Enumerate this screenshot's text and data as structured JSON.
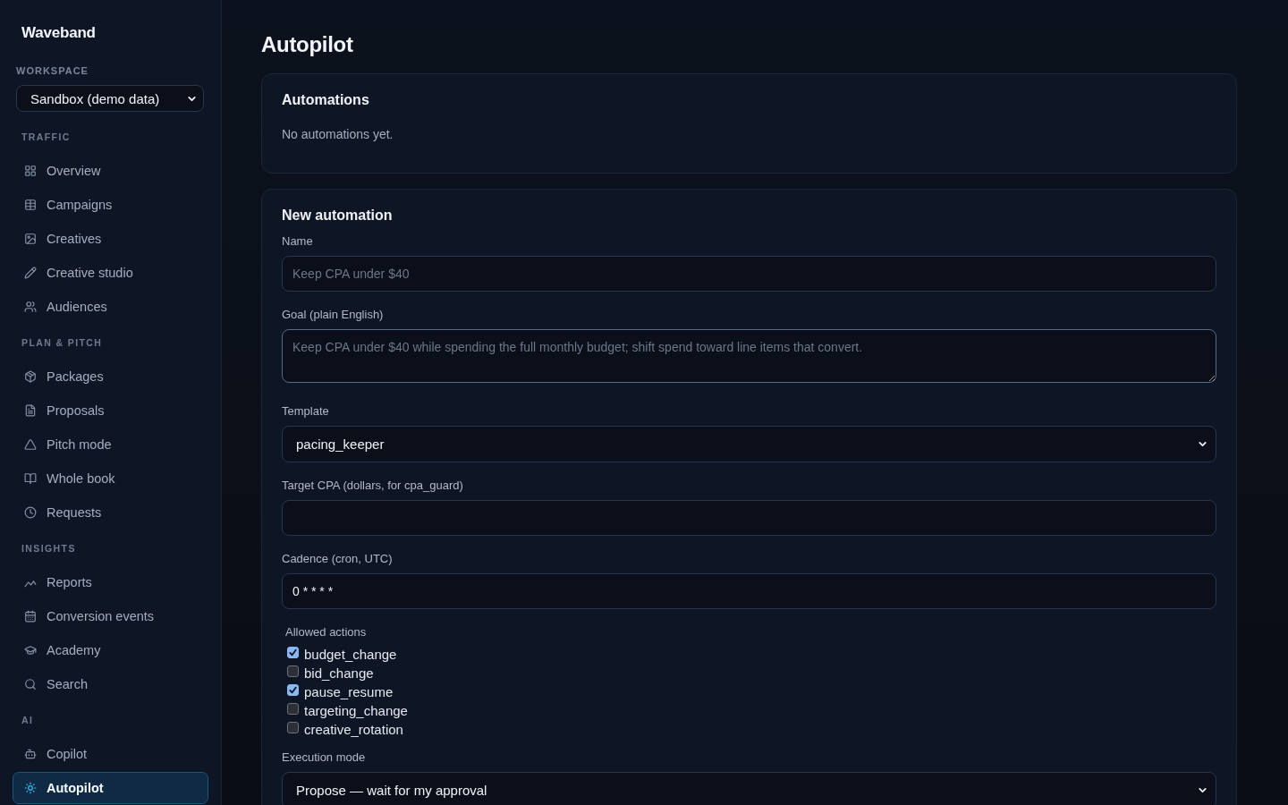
{
  "sidebar": {
    "brand": "Waveband",
    "workspace": {
      "label": "WORKSPACE",
      "value": "Sandbox (demo data)"
    },
    "sections": [
      {
        "title": "TRAFFIC",
        "items": [
          {
            "label": "Overview",
            "selected": false
          },
          {
            "label": "Campaigns",
            "selected": false
          },
          {
            "label": "Creatives",
            "selected": false
          },
          {
            "label": "Creative studio",
            "selected": false
          },
          {
            "label": "Audiences",
            "selected": false
          }
        ]
      },
      {
        "title": "PLAN & PITCH",
        "items": [
          {
            "label": "Packages",
            "selected": false
          },
          {
            "label": "Proposals",
            "selected": false
          },
          {
            "label": "Pitch mode",
            "selected": false
          },
          {
            "label": "Whole book",
            "selected": false
          },
          {
            "label": "Requests",
            "selected": false
          }
        ]
      },
      {
        "title": "INSIGHTS",
        "items": [
          {
            "label": "Reports",
            "selected": false
          },
          {
            "label": "Conversion events",
            "selected": false
          },
          {
            "label": "Academy",
            "selected": false
          },
          {
            "label": "Search",
            "selected": false
          }
        ]
      },
      {
        "title": "AI",
        "items": [
          {
            "label": "Copilot",
            "selected": false
          },
          {
            "label": "Autopilot",
            "selected": true
          }
        ]
      }
    ]
  },
  "page": {
    "title": "Autopilot"
  },
  "automations_card": {
    "title": "Automations",
    "empty_text": "No automations yet."
  },
  "new_automation_card": {
    "title": "New automation",
    "fields": [
      {
        "kind": "input",
        "label": "Name",
        "placeholder": "Keep CPA under $40"
      },
      {
        "kind": "textarea",
        "label": "Goal (plain English)",
        "placeholder": "Keep CPA under $40 while spending the full monthly budget; shift spend toward line items that convert."
      },
      {
        "kind": "select",
        "label": "Template",
        "value": "pacing_keeper"
      },
      {
        "kind": "input",
        "label": "Target CPA (dollars, for cpa_guard)"
      },
      {
        "kind": "input",
        "label": "Cadence (cron, UTC)",
        "value": "0 * * * *"
      },
      {
        "kind": "checkboxes",
        "label": "Allowed actions",
        "options": [
          {
            "label": "budget_change",
            "checked": true
          },
          {
            "label": "bid_change",
            "checked": false
          },
          {
            "label": "pause_resume",
            "checked": true
          },
          {
            "label": "targeting_change",
            "checked": false
          },
          {
            "label": "creative_rotation",
            "checked": false
          }
        ]
      },
      {
        "kind": "select",
        "label": "Execution mode",
        "value": "Propose — wait for my approval"
      }
    ]
  }
}
